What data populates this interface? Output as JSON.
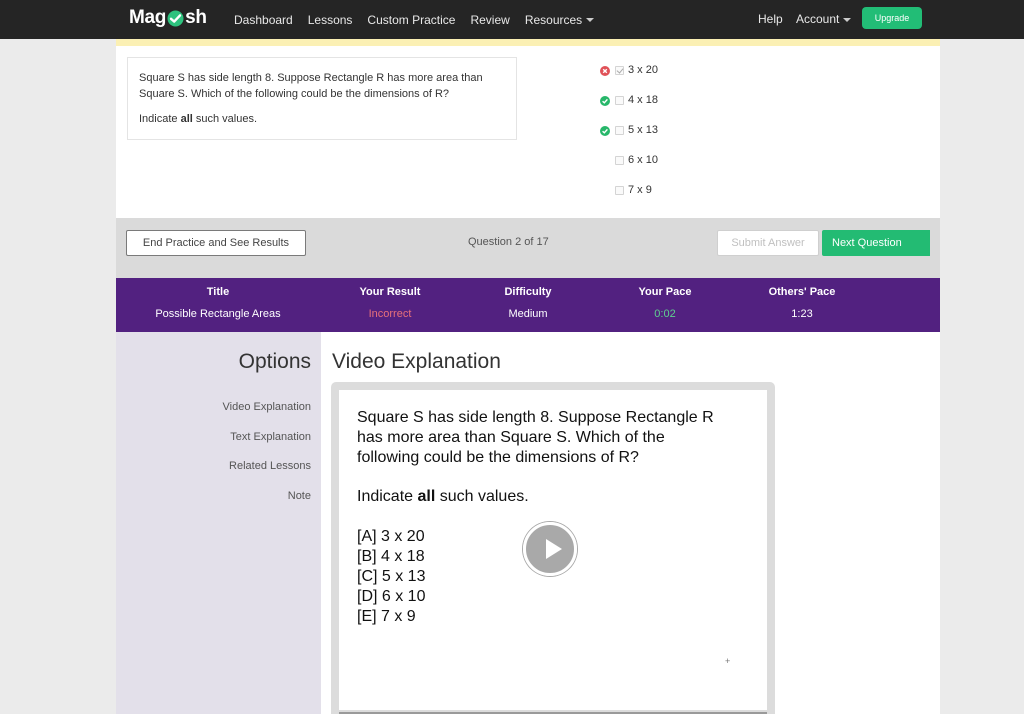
{
  "nav": {
    "logo_left": "Mag",
    "logo_right": "sh",
    "links": [
      "Dashboard",
      "Lessons",
      "Custom Practice",
      "Review",
      "Resources"
    ],
    "help": "Help",
    "account": "Account",
    "upgrade": "Upgrade"
  },
  "question": {
    "text": "Square S has side length 8. Suppose Rectangle R has more area than Square S. Which of the following could be the dimensions of R?",
    "instruction_pre": "Indicate ",
    "instruction_bold": "all",
    "instruction_post": " such values.",
    "choices": [
      {
        "label": "3 x 20",
        "status": "incorrect",
        "checked": true
      },
      {
        "label": "4 x 18",
        "status": "correct",
        "checked": false
      },
      {
        "label": "5 x 13",
        "status": "correct",
        "checked": false
      },
      {
        "label": "6 x 10",
        "status": "none",
        "checked": false
      },
      {
        "label": "7 x 9",
        "status": "none",
        "checked": false
      }
    ]
  },
  "controls": {
    "end_practice": "End Practice and See Results",
    "question_count": "Question 2 of 17",
    "submit": "Submit Answer",
    "next": "Next Question"
  },
  "results": {
    "headers": [
      "Title",
      "Your Result",
      "Difficulty",
      "Your Pace",
      "Others' Pace"
    ],
    "values": [
      "Possible Rectangle Areas",
      "Incorrect",
      "Medium",
      "0:02",
      "1:23"
    ],
    "colors": {
      "incorrect": "#e8707a",
      "pace_good": "#5fcf8f",
      "banner": "#522180"
    }
  },
  "options": {
    "title": "Options",
    "items": [
      "Video Explanation",
      "Text Explanation",
      "Related Lessons",
      "Note"
    ]
  },
  "video": {
    "title": "Video Explanation",
    "line1": "Square S has side length 8.  Suppose Rectangle R",
    "line2": "has more area than Square S.  Which of the",
    "line3": "following could be the dimensions of R?",
    "indicate_pre": "Indicate ",
    "indicate_bold": "all",
    "indicate_post": " such values.",
    "answers": [
      "[A] 3 x 20",
      "[B] 4 x 18",
      "[C] 5 x 13",
      "[D] 6 x 10",
      "[E] 7 x 9"
    ],
    "plus": "+"
  },
  "accent_colors": {
    "green": "#23bb73",
    "purple": "#522180",
    "nav_bg": "#252525"
  }
}
